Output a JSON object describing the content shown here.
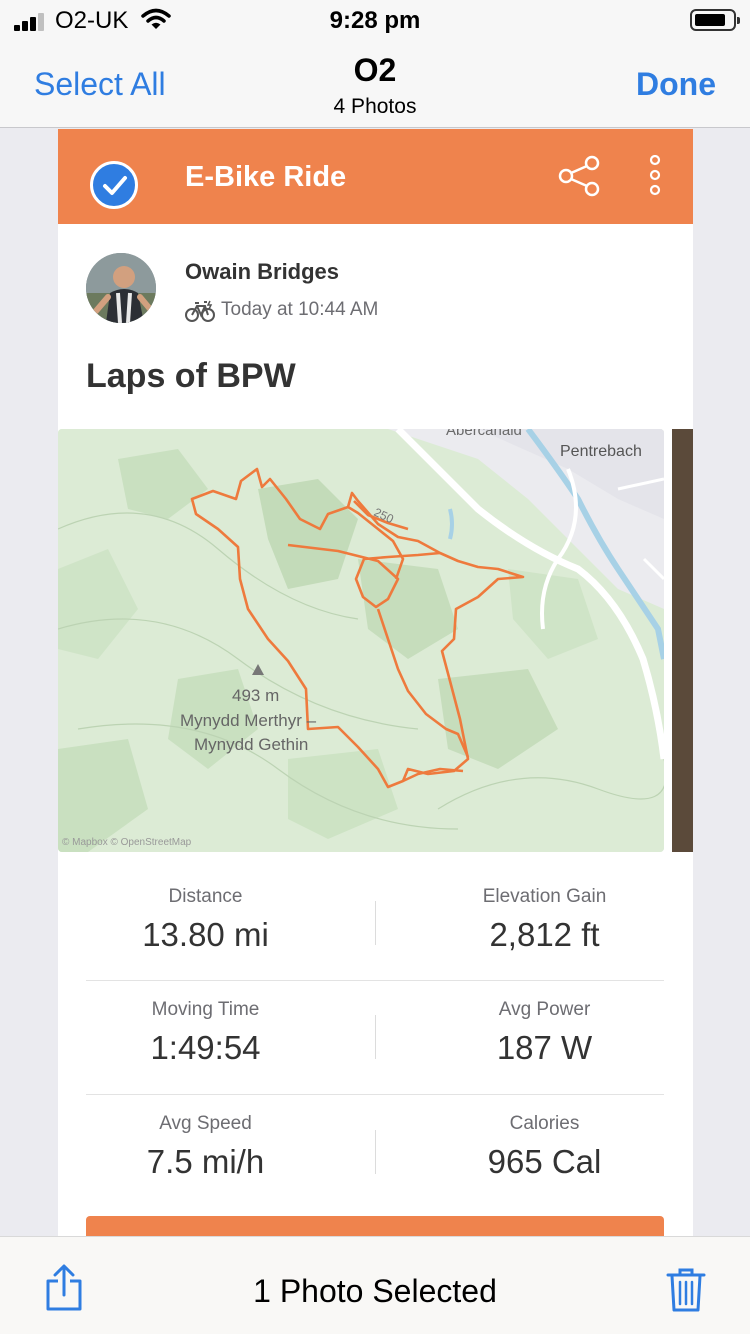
{
  "status_bar": {
    "carrier": "O2-UK",
    "time": "9:28 pm",
    "signal_bars": 3,
    "battery_level": 0.75
  },
  "nav": {
    "select_all": "Select All",
    "title": "O2",
    "subtitle": "4 Photos",
    "done": "Done"
  },
  "activity": {
    "header_title": "E-Bike Ride",
    "athlete": "Owain Bridges",
    "time": "Today at 10:44 AM",
    "name": "Laps of BPW",
    "map": {
      "places": [
        "Abercanaid",
        "Pentrebach",
        "493 m",
        "Mynydd Merthyr –",
        "Mynydd Gethin",
        "250"
      ],
      "attribution": "© Mapbox © OpenStreetMap"
    },
    "stats": [
      {
        "label": "Distance",
        "value": "13.80 mi"
      },
      {
        "label": "Elevation Gain",
        "value": "2,812 ft"
      },
      {
        "label": "Moving Time",
        "value": "1:49:54"
      },
      {
        "label": "Avg Power",
        "value": "187 W"
      },
      {
        "label": "Avg Speed",
        "value": "7.5 mi/h"
      },
      {
        "label": "Calories",
        "value": "965 Cal"
      }
    ]
  },
  "toolbar": {
    "selection_label": "1 Photo Selected"
  },
  "colors": {
    "accent": "#2f7de1",
    "strava_orange": "#ef834d",
    "map_green": "#dcebd5",
    "route": "#ee7a3d"
  },
  "icons": [
    "cellular-signal-icon",
    "wifi-icon",
    "battery-icon",
    "checkmark-icon",
    "share-icon",
    "more-vertical-icon",
    "bike-icon",
    "share-sheet-icon",
    "trash-icon"
  ]
}
